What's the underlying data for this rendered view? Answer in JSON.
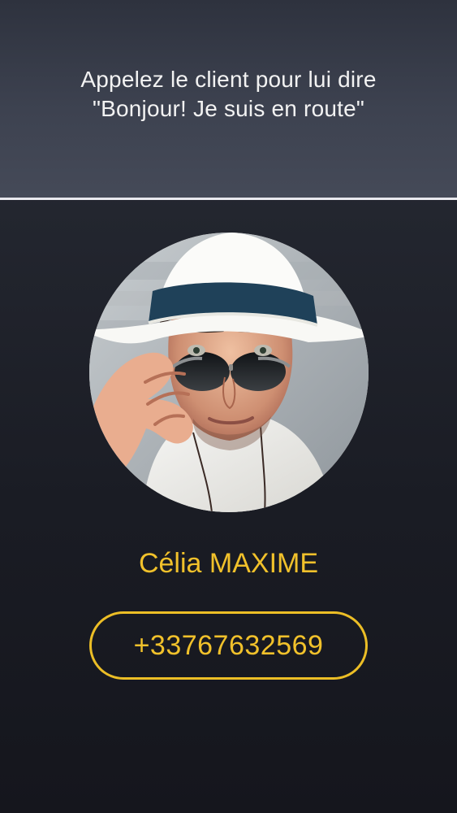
{
  "header": {
    "instruction": "Appelez le client pour lui dire \"Bonjour! Je suis en route\""
  },
  "client": {
    "name": "Célia MAXIME",
    "phone": "+33767632569",
    "avatar_icon": "profile-photo"
  },
  "colors": {
    "accent": "#f1c12b",
    "background": "#1a1c24",
    "divider": "#e9e9ee"
  }
}
